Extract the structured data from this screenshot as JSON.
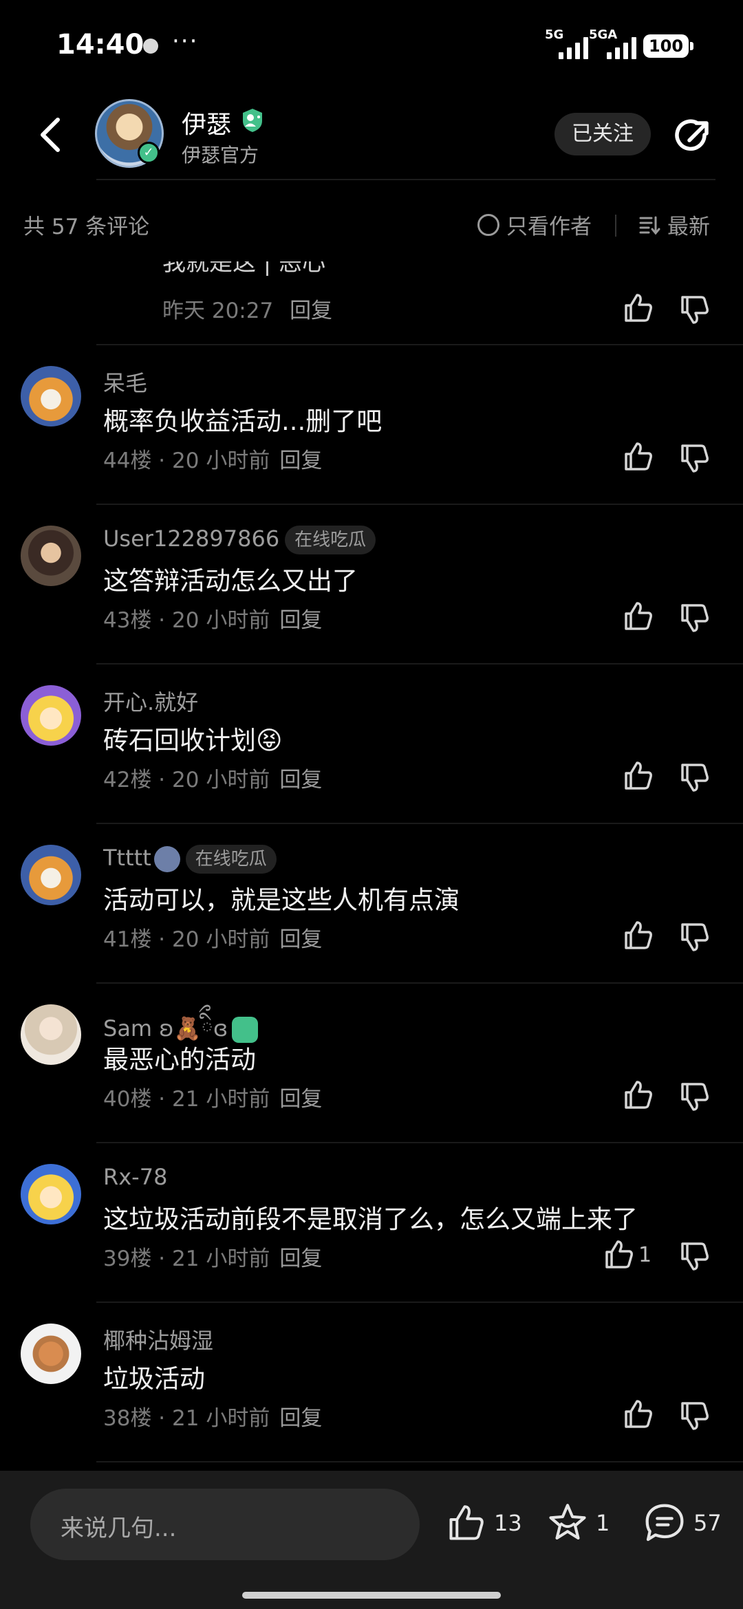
{
  "status_bar": {
    "time": "14:40",
    "more": "···",
    "signal1_label": "5G",
    "signal2_label": "5GA",
    "battery": "100"
  },
  "header": {
    "author_name": "伊瑟",
    "author_subtitle": "伊瑟官方",
    "follow_label": "已关注"
  },
  "filter_bar": {
    "comment_count": "共 57 条评论",
    "only_author": "只看作者",
    "sort": "最新"
  },
  "partial_comment": {
    "text": "我就是这 | 恶心",
    "time": "昨天 20:27",
    "reply": "回复"
  },
  "comments": [
    {
      "username": "呆毛",
      "tag": "",
      "content": "概率负收益活动...删了吧",
      "floor": "44楼",
      "time": "20 小时前",
      "reply": "回复",
      "likes": ""
    },
    {
      "username": "User122897866",
      "tag": "在线吃瓜",
      "content": "这答辩活动怎么又出了",
      "floor": "43楼",
      "time": "20 小时前",
      "reply": "回复",
      "likes": ""
    },
    {
      "username": "开心.就好",
      "tag": "",
      "content": "砖石回收计划😝",
      "floor": "42楼",
      "time": "20 小时前",
      "reply": "回复",
      "likes": ""
    },
    {
      "username": "Ttttt",
      "tag": "在线吃瓜",
      "content": "活动可以，就是这些人机有点演",
      "floor": "41楼",
      "time": "20 小时前",
      "reply": "回复",
      "likes": ""
    },
    {
      "username": "Sam ʚ🧸ིྀɞ",
      "tag": "",
      "content": "最恶心的活动",
      "floor": "40楼",
      "time": "21 小时前",
      "reply": "回复",
      "likes": ""
    },
    {
      "username": "Rx-78",
      "tag": "",
      "content": "这垃圾活动前段不是取消了么，怎么又端上来了",
      "floor": "39楼",
      "time": "21 小时前",
      "reply": "回复",
      "likes": "1"
    },
    {
      "username": "椰种沾姆湿",
      "tag": "",
      "content": "垃圾活动",
      "floor": "38楼",
      "time": "21 小时前",
      "reply": "回复",
      "likes": ""
    }
  ],
  "bottom_bar": {
    "placeholder": "来说几句...",
    "likes": "13",
    "favorites": "1",
    "comments": "57"
  },
  "colors": {
    "background": "#000000",
    "verified_green": "#43c08a",
    "muted_text": "#9c9c9c"
  }
}
